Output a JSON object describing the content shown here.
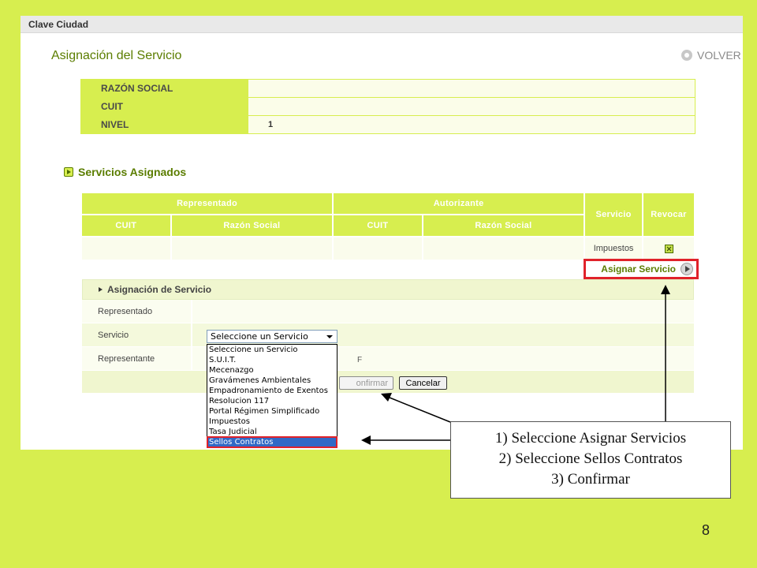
{
  "app": {
    "title": "Clave Ciudad"
  },
  "page": {
    "title": "Asignación del Servicio",
    "back_label": "VOLVER"
  },
  "info": {
    "rows": [
      {
        "label": "RAZÓN SOCIAL",
        "value": ""
      },
      {
        "label": "CUIT",
        "value": ""
      },
      {
        "label": "NIVEL",
        "value": "1"
      }
    ]
  },
  "services": {
    "section_title": "Servicios Asignados",
    "group_headers": {
      "represented": "Representado",
      "authorizer": "Autorizante",
      "service": "Servicio",
      "revoke": "Revocar"
    },
    "sub_headers": {
      "cuit_1": "CUIT",
      "razon_1": "Razón Social",
      "cuit_2": "CUIT",
      "razon_2": "Razón Social"
    },
    "rows": [
      {
        "rep_cuit": "",
        "rep_razon": "",
        "aut_cuit": "",
        "aut_razon": "",
        "service": "Impuestos"
      }
    ],
    "assign_button": "Asignar Servicio"
  },
  "form": {
    "header": "Asignación de Servicio",
    "rows": [
      {
        "label": "Representado"
      },
      {
        "label": "Servicio"
      },
      {
        "label": "Representante"
      }
    ],
    "service_select": {
      "value": "Seleccione un Servicio",
      "options": [
        "Seleccione un Servicio",
        "S.U.I.T.",
        "Mecenazgo",
        "Gravámenes Ambientales",
        "Empadronamiento de Exentos",
        "Resolucion 117",
        "Portal Régimen Simplificado",
        "Impuestos",
        "Tasa Judicial",
        "Sellos Contratos"
      ],
      "selected": "Sellos Contratos"
    },
    "representante_fragment": "F",
    "confirm_label": "onfirmar",
    "cancel_label": "Cancelar"
  },
  "instructions": [
    "1)   Seleccione Asignar Servicios",
    "2)   Seleccione Sellos Contratos",
    "3)   Confirmar"
  ],
  "slide_number": "8",
  "colors": {
    "background": "#d7ee4f",
    "accent": "#5b7d00",
    "highlight": "#e0222a",
    "selection": "#3169c6"
  }
}
